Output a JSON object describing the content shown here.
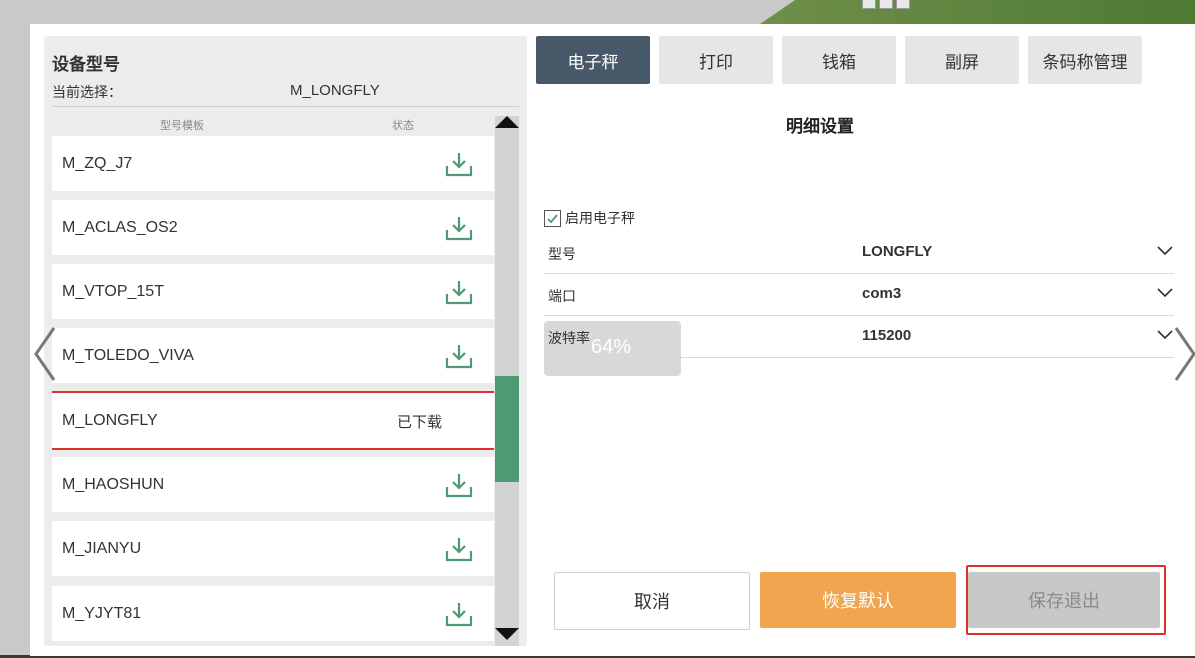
{
  "left_panel": {
    "title": "设备型号",
    "current_label": "当前选择：",
    "current_value": "M_LONGFLY",
    "col_model": "型号模板",
    "col_status": "状态",
    "rows": [
      {
        "name": "M_ZQ_J7",
        "status": "download",
        "status_text": ""
      },
      {
        "name": "M_ACLAS_OS2",
        "status": "download",
        "status_text": ""
      },
      {
        "name": "M_VTOP_15T",
        "status": "download",
        "status_text": ""
      },
      {
        "name": "M_TOLEDO_VIVA",
        "status": "download",
        "status_text": ""
      },
      {
        "name": "M_LONGFLY",
        "status": "downloaded",
        "status_text": "已下载"
      },
      {
        "name": "M_HAOSHUN",
        "status": "download",
        "status_text": ""
      },
      {
        "name": "M_JIANYU",
        "status": "download",
        "status_text": ""
      },
      {
        "name": "M_YJYT81",
        "status": "download",
        "status_text": ""
      }
    ]
  },
  "tabs": [
    {
      "label": "电子秤",
      "active": true
    },
    {
      "label": "打印",
      "active": false
    },
    {
      "label": "钱箱",
      "active": false
    },
    {
      "label": "副屏",
      "active": false
    },
    {
      "label": "条码称管理",
      "active": false
    }
  ],
  "detail": {
    "title": "明细设置",
    "enable_label": "启用电子秤",
    "enable_checked": true,
    "fields": [
      {
        "label": "型号",
        "value": "LONGFLY"
      },
      {
        "label": "端口",
        "value": "com3"
      },
      {
        "label": "波特率",
        "value": "115200"
      }
    ],
    "progress_text": "64%"
  },
  "buttons": {
    "cancel": "取消",
    "reset": "恢复默认",
    "save": "保存退出"
  },
  "colors": {
    "active_tab": "#475868",
    "reset_button": "#f0a54e",
    "scroll_thumb": "#4e9a72",
    "highlight": "#e0302a",
    "download_icon": "#4e9a72"
  }
}
